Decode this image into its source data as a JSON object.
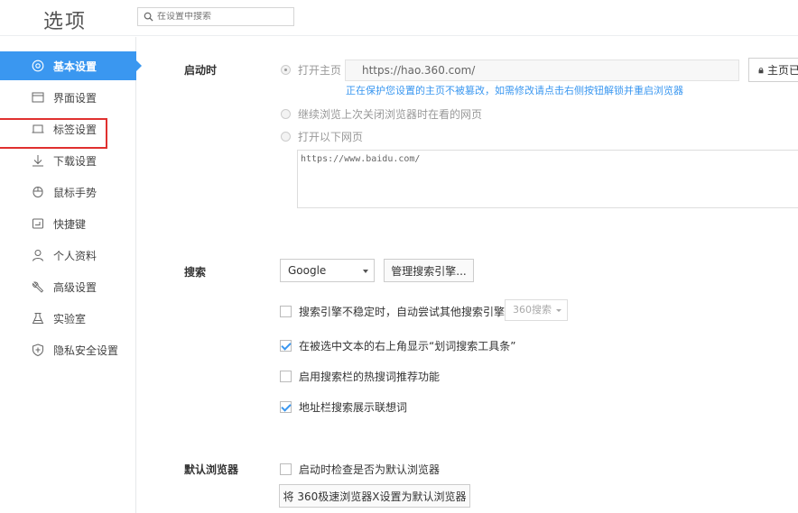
{
  "header": {
    "title": "选项",
    "search_placeholder": "在设置中搜索"
  },
  "sidebar": {
    "items": [
      {
        "label": "基本设置",
        "icon": "target-icon",
        "active": true
      },
      {
        "label": "界面设置",
        "icon": "window-icon"
      },
      {
        "label": "标签设置",
        "icon": "tab-icon",
        "highlighted": true
      },
      {
        "label": "下载设置",
        "icon": "download-icon"
      },
      {
        "label": "鼠标手势",
        "icon": "mouse-icon"
      },
      {
        "label": "快捷键",
        "icon": "keyboard-icon"
      },
      {
        "label": "个人资料",
        "icon": "person-icon"
      },
      {
        "label": "高级设置",
        "icon": "wrench-icon"
      },
      {
        "label": "实验室",
        "icon": "flask-icon"
      },
      {
        "label": "隐私安全设置",
        "icon": "shield-icon"
      }
    ]
  },
  "startup": {
    "label": "启动时",
    "open_home_label": "打开主页",
    "home_url": "https://hao.360.com/",
    "lock_button_label": "主页已锁",
    "notice": "正在保护您设置的主页不被篡改，如需修改请点击右侧按钮解锁并重启浏览器",
    "continue_label": "继续浏览上次关闭浏览器时在看的网页",
    "open_pages_label": "打开以下网页",
    "pages_text": "https://www.baidu.com/"
  },
  "search": {
    "label": "搜索",
    "engine": "Google",
    "manage_button": "管理搜索引擎...",
    "fallback_label": "搜索引擎不稳定时，自动尝试其他搜索引擎：",
    "fallback_engine": "360搜索",
    "fallback_checked": false,
    "toolbar_label": "在被选中文本的右上角显示“划词搜索工具条”",
    "toolbar_checked": true,
    "hotwords_label": "启用搜索栏的热搜词推荐功能",
    "hotwords_checked": false,
    "suggest_label": "地址栏搜索展示联想词",
    "suggest_checked": true
  },
  "default_browser": {
    "label": "默认浏览器",
    "check_label": "启动时检查是否为默认浏览器",
    "check_checked": false,
    "set_button": "将 360极速浏览器X设置为默认浏览器"
  },
  "colors": {
    "accent": "#3a97f0",
    "highlight": "#e0302f"
  }
}
